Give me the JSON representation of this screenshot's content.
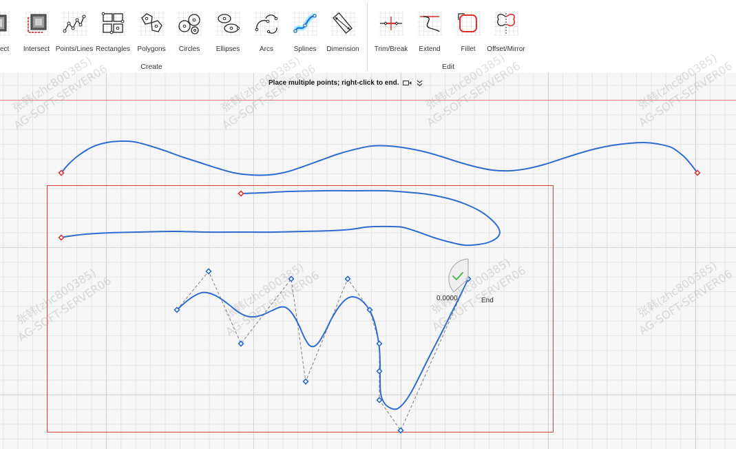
{
  "ribbon": {
    "partial_tool": {
      "label": "ect",
      "icon": "connect-icon"
    },
    "create_group": {
      "label": "Create",
      "tools": [
        {
          "label": "Intersect",
          "icon": "intersect-icon"
        },
        {
          "label": "Points/Lines",
          "icon": "points-lines-icon"
        },
        {
          "label": "Rectangles",
          "icon": "rectangles-icon"
        },
        {
          "label": "Polygons",
          "icon": "polygons-icon"
        },
        {
          "label": "Circles",
          "icon": "circles-icon"
        },
        {
          "label": "Ellipses",
          "icon": "ellipses-icon"
        },
        {
          "label": "Arcs",
          "icon": "arcs-icon"
        },
        {
          "label": "Splines",
          "icon": "splines-icon",
          "active": true
        },
        {
          "label": "Dimension",
          "icon": "dimension-icon"
        }
      ]
    },
    "edit_group": {
      "label": "Edit",
      "tools": [
        {
          "label": "Trim/Break",
          "icon": "trim-break-icon"
        },
        {
          "label": "Extend",
          "icon": "extend-icon"
        },
        {
          "label": "Fillet",
          "icon": "fillet-icon"
        },
        {
          "label": "Offset/Mirror",
          "icon": "offset-mirror-icon"
        }
      ]
    }
  },
  "prompt": {
    "text": "Place multiple points; right-click to end.",
    "video_icon": "video-icon",
    "expand_icon": "double-chevron-down-icon"
  },
  "sketch": {
    "tip_value": "0.0000",
    "tip_label": "End",
    "confirm_icon": "checkmark-icon"
  },
  "colors": {
    "curve": "#2d6ccf",
    "axis_line": "#e07a7a",
    "boundary": "#d63a3a",
    "endpoint_marker": "#d63a3a",
    "control_point": "#2d6ccf",
    "control_polygon": "#7d7d7d",
    "active_tool_glow": "#8fe3ff",
    "checkmark": "#52b452"
  },
  "watermark": {
    "line1": "张韩(zhc800385)",
    "line2": "AG-SOFT-SERVER06"
  }
}
